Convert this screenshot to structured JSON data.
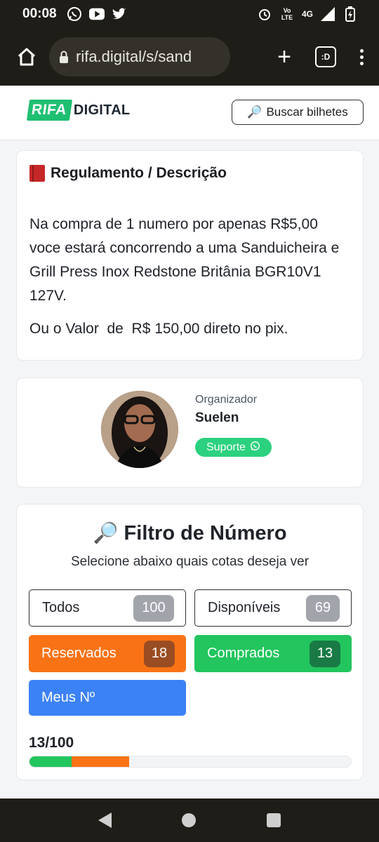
{
  "status_bar": {
    "time": "00:08",
    "left_icons": [
      "whatsapp-icon",
      "youtube-icon",
      "twitter-icon"
    ],
    "right_icons": [
      "alarm-icon",
      "volte-icon",
      "signal-icon",
      "battery-charging-icon"
    ],
    "volte_text": "Vo LTE",
    "network": "4G"
  },
  "browser": {
    "url": "rifa.digital/s/sand",
    "tab_count": ":D"
  },
  "header": {
    "logo_part1": "RIFA",
    "logo_part2": "DIGITAL",
    "search_button": "Buscar bilhetes"
  },
  "regulamento": {
    "title": "Regulamento / Descrição",
    "description": "Na compra de 1 numero por apenas R$5,00 voce estará concorrendo a uma Sanduicheira e Grill Press Inox Redstone Britânia BGR10V1 127V.",
    "pix_text": "Ou o Valor  de  R$ 150,00 direto no pix."
  },
  "organizador": {
    "label": "Organizador",
    "name": "Suelen",
    "support_button": "Suporte"
  },
  "filtro": {
    "title": "Filtro de Número",
    "subtitle": "Selecione abaixo quais cotas deseja ver",
    "buttons": [
      {
        "label": "Todos",
        "count": "100"
      },
      {
        "label": "Disponíveis",
        "count": "69"
      },
      {
        "label": "Reservados",
        "count": "18"
      },
      {
        "label": "Comprados",
        "count": "13"
      },
      {
        "label": "Meus Nº"
      }
    ],
    "progress_text": "13/100",
    "progress": {
      "comprados": 13,
      "reservados": 18,
      "total": 100
    }
  },
  "colors": {
    "brand_green": "#1fbf72",
    "reservados": "#f97316",
    "comprados": "#22c55e",
    "meus": "#3b82f6"
  }
}
